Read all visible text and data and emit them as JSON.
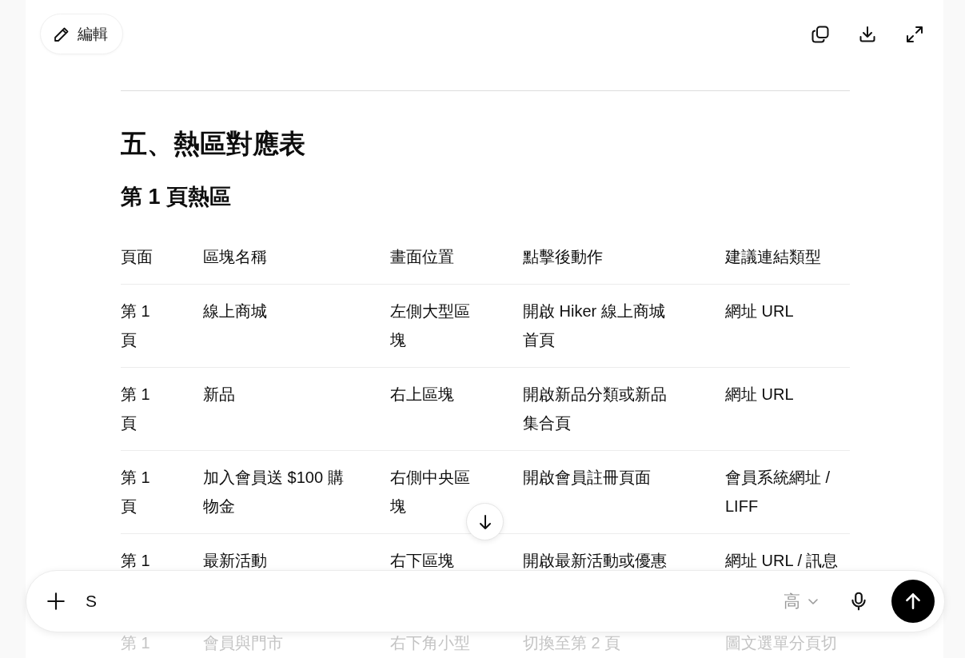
{
  "toolbar": {
    "edit_button": "編輯"
  },
  "document": {
    "heading": "五、熱區對應表",
    "subheading": "第 1 頁熱區",
    "table": {
      "columns": [
        "頁面",
        "區塊名稱",
        "畫面位置",
        "點擊後動作",
        "建議連結類型"
      ],
      "rows": [
        {
          "dimmed": false,
          "cells": [
            "第 1 頁",
            "線上商城",
            "左側大型區塊",
            "開啟 Hiker 線上商城首頁",
            "網址 URL"
          ]
        },
        {
          "dimmed": false,
          "cells": [
            "第 1 頁",
            "新品",
            "右上區塊",
            "開啟新品分類或新品集合頁",
            "網址 URL"
          ]
        },
        {
          "dimmed": false,
          "cells": [
            "第 1 頁",
            "加入會員送 $100 購物金",
            "右側中央區塊",
            "開啟會員註冊頁面",
            "會員系統網址 / LIFF"
          ]
        },
        {
          "dimmed": false,
          "cells": [
            "第 1",
            "最新活動",
            "右下區塊",
            "開啟最新活動或優惠",
            "網址 URL / 訊息"
          ]
        },
        {
          "dimmed": true,
          "cells": [
            "第 1",
            "會員與門市",
            "右下角小型",
            "切換至第 2 頁",
            "圖文選單分頁切"
          ]
        }
      ]
    }
  },
  "composer": {
    "value": "S",
    "effort": "高"
  }
}
